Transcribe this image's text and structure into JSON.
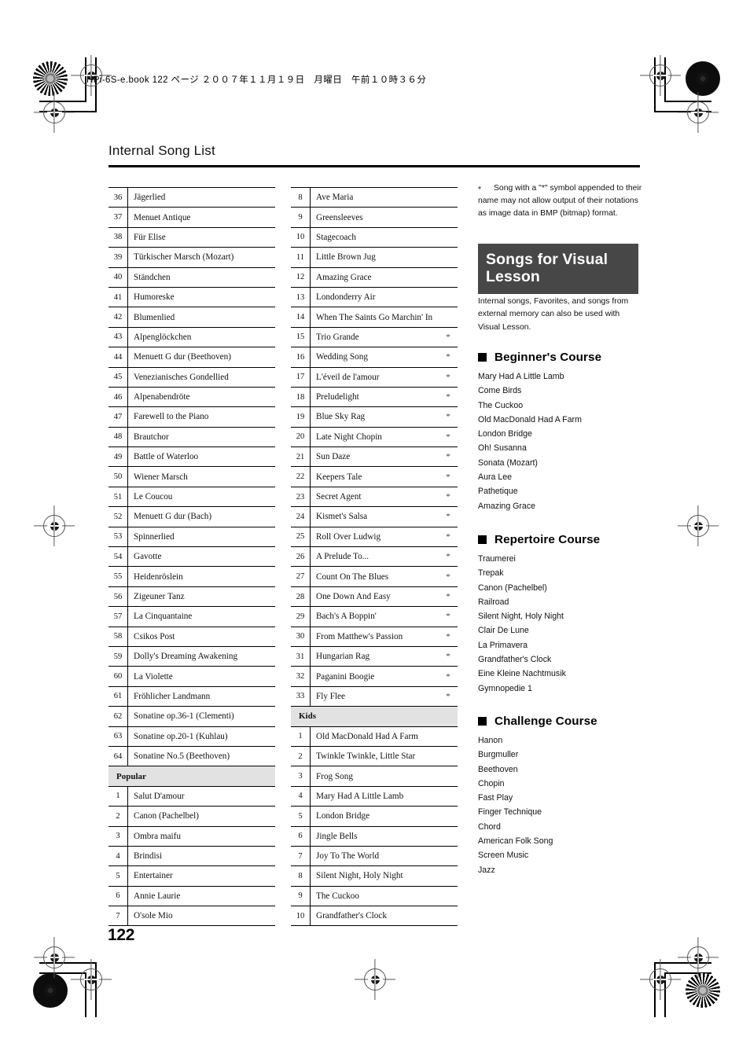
{
  "document": {
    "meta_line": "HPi-6S-e.book  122 ページ  ２００７年１１月１９日　月曜日　午前１０時３６分",
    "header_title": "Internal Song List",
    "page_number": "122"
  },
  "footnote": {
    "marker": "*",
    "text": "Song with a \"*\" symbol appended to their name may not allow output of their notations as image data in BMP (bitmap) format."
  },
  "banner": {
    "title": "Songs for Visual Lesson"
  },
  "intro": {
    "text": "Internal songs, Favorites, and songs from external memory can also be used with Visual Lesson."
  },
  "tables": {
    "column1": [
      {
        "type": "row",
        "num": "36",
        "name": "Jägerlied",
        "mark": ""
      },
      {
        "type": "row",
        "num": "37",
        "name": "Menuet Antique",
        "mark": ""
      },
      {
        "type": "row",
        "num": "38",
        "name": "Für Elise",
        "mark": ""
      },
      {
        "type": "row",
        "num": "39",
        "name": "Türkischer Marsch (Mozart)",
        "mark": ""
      },
      {
        "type": "row",
        "num": "40",
        "name": "Ständchen",
        "mark": ""
      },
      {
        "type": "row",
        "num": "41",
        "name": "Humoreske",
        "mark": ""
      },
      {
        "type": "row",
        "num": "42",
        "name": "Blumenlied",
        "mark": ""
      },
      {
        "type": "row",
        "num": "43",
        "name": "Alpenglöckchen",
        "mark": ""
      },
      {
        "type": "row",
        "num": "44",
        "name": "Menuett G dur (Beethoven)",
        "mark": ""
      },
      {
        "type": "row",
        "num": "45",
        "name": "Venezianisches Gondellied",
        "mark": ""
      },
      {
        "type": "row",
        "num": "46",
        "name": "Alpenabendröte",
        "mark": ""
      },
      {
        "type": "row",
        "num": "47",
        "name": "Farewell to the Piano",
        "mark": ""
      },
      {
        "type": "row",
        "num": "48",
        "name": "Brautchor",
        "mark": ""
      },
      {
        "type": "row",
        "num": "49",
        "name": "Battle of Waterloo",
        "mark": ""
      },
      {
        "type": "row",
        "num": "50",
        "name": "Wiener Marsch",
        "mark": ""
      },
      {
        "type": "row",
        "num": "51",
        "name": "Le Coucou",
        "mark": ""
      },
      {
        "type": "row",
        "num": "52",
        "name": "Menuett G dur (Bach)",
        "mark": ""
      },
      {
        "type": "row",
        "num": "53",
        "name": "Spinnerlied",
        "mark": ""
      },
      {
        "type": "row",
        "num": "54",
        "name": "Gavotte",
        "mark": ""
      },
      {
        "type": "row",
        "num": "55",
        "name": "Heidenröslein",
        "mark": ""
      },
      {
        "type": "row",
        "num": "56",
        "name": "Zigeuner Tanz",
        "mark": ""
      },
      {
        "type": "row",
        "num": "57",
        "name": "La Cinquantaine",
        "mark": ""
      },
      {
        "type": "row",
        "num": "58",
        "name": "Csikos Post",
        "mark": ""
      },
      {
        "type": "row",
        "num": "59",
        "name": "Dolly's Dreaming Awakening",
        "mark": ""
      },
      {
        "type": "row",
        "num": "60",
        "name": "La Violette",
        "mark": ""
      },
      {
        "type": "row",
        "num": "61",
        "name": "Fröhlicher Landmann",
        "mark": ""
      },
      {
        "type": "row",
        "num": "62",
        "name": "Sonatine op.36-1 (Clementi)",
        "mark": ""
      },
      {
        "type": "row",
        "num": "63",
        "name": "Sonatine op.20-1 (Kuhlau)",
        "mark": ""
      },
      {
        "type": "row",
        "num": "64",
        "name": "Sonatine No.5 (Beethoven)",
        "mark": ""
      },
      {
        "type": "section",
        "label": "Popular"
      },
      {
        "type": "row",
        "num": "1",
        "name": "Salut D'amour",
        "mark": ""
      },
      {
        "type": "row",
        "num": "2",
        "name": "Canon (Pachelbel)",
        "mark": ""
      },
      {
        "type": "row",
        "num": "3",
        "name": "Ombra maifu",
        "mark": ""
      },
      {
        "type": "row",
        "num": "4",
        "name": "Brindisi",
        "mark": ""
      },
      {
        "type": "row",
        "num": "5",
        "name": "Entertainer",
        "mark": ""
      },
      {
        "type": "row",
        "num": "6",
        "name": "Annie Laurie",
        "mark": ""
      },
      {
        "type": "row",
        "num": "7",
        "name": "O'sole Mio",
        "mark": ""
      }
    ],
    "column2": [
      {
        "type": "row",
        "num": "8",
        "name": "Ave Maria",
        "mark": ""
      },
      {
        "type": "row",
        "num": "9",
        "name": "Greensleeves",
        "mark": ""
      },
      {
        "type": "row",
        "num": "10",
        "name": "Stagecoach",
        "mark": ""
      },
      {
        "type": "row",
        "num": "11",
        "name": "Little Brown Jug",
        "mark": ""
      },
      {
        "type": "row",
        "num": "12",
        "name": "Amazing Grace",
        "mark": ""
      },
      {
        "type": "row",
        "num": "13",
        "name": "Londonderry Air",
        "mark": ""
      },
      {
        "type": "row",
        "num": "14",
        "name": "When The Saints Go Marchin' In",
        "mark": ""
      },
      {
        "type": "row",
        "num": "15",
        "name": "Trio Grande",
        "mark": "*"
      },
      {
        "type": "row",
        "num": "16",
        "name": "Wedding Song",
        "mark": "*"
      },
      {
        "type": "row",
        "num": "17",
        "name": "L'éveil de l'amour",
        "mark": "*"
      },
      {
        "type": "row",
        "num": "18",
        "name": "Preludelight",
        "mark": "*"
      },
      {
        "type": "row",
        "num": "19",
        "name": "Blue Sky Rag",
        "mark": "*"
      },
      {
        "type": "row",
        "num": "20",
        "name": "Late Night Chopin",
        "mark": "*"
      },
      {
        "type": "row",
        "num": "21",
        "name": "Sun Daze",
        "mark": "*"
      },
      {
        "type": "row",
        "num": "22",
        "name": "Keepers Tale",
        "mark": "*"
      },
      {
        "type": "row",
        "num": "23",
        "name": "Secret Agent",
        "mark": "*"
      },
      {
        "type": "row",
        "num": "24",
        "name": "Kismet's Salsa",
        "mark": "*"
      },
      {
        "type": "row",
        "num": "25",
        "name": "Roll Over Ludwig",
        "mark": "*"
      },
      {
        "type": "row",
        "num": "26",
        "name": "A Prelude To...",
        "mark": "*"
      },
      {
        "type": "row",
        "num": "27",
        "name": "Count On The Blues",
        "mark": "*"
      },
      {
        "type": "row",
        "num": "28",
        "name": "One Down And Easy",
        "mark": "*"
      },
      {
        "type": "row",
        "num": "29",
        "name": "Bach's A Boppin'",
        "mark": "*"
      },
      {
        "type": "row",
        "num": "30",
        "name": "From Matthew's Passion",
        "mark": "*"
      },
      {
        "type": "row",
        "num": "31",
        "name": "Hungarian Rag",
        "mark": "*"
      },
      {
        "type": "row",
        "num": "32",
        "name": "Paganini Boogie",
        "mark": "*"
      },
      {
        "type": "row",
        "num": "33",
        "name": "Fly Flee",
        "mark": "*"
      },
      {
        "type": "section",
        "label": "Kids"
      },
      {
        "type": "row",
        "num": "1",
        "name": "Old MacDonald Had A Farm",
        "mark": ""
      },
      {
        "type": "row",
        "num": "2",
        "name": "Twinkle Twinkle, Little Star",
        "mark": ""
      },
      {
        "type": "row",
        "num": "3",
        "name": "Frog Song",
        "mark": ""
      },
      {
        "type": "row",
        "num": "4",
        "name": "Mary Had A Little Lamb",
        "mark": ""
      },
      {
        "type": "row",
        "num": "5",
        "name": "London Bridge",
        "mark": ""
      },
      {
        "type": "row",
        "num": "6",
        "name": "Jingle Bells",
        "mark": ""
      },
      {
        "type": "row",
        "num": "7",
        "name": "Joy To The World",
        "mark": ""
      },
      {
        "type": "row",
        "num": "8",
        "name": "Silent Night, Holy Night",
        "mark": ""
      },
      {
        "type": "row",
        "num": "9",
        "name": "The Cuckoo",
        "mark": ""
      },
      {
        "type": "row",
        "num": "10",
        "name": "Grandfather's Clock",
        "mark": ""
      }
    ]
  },
  "courses": [
    {
      "id": "beginner",
      "title": "Beginner's Course",
      "songs": [
        "Mary Had A Little Lamb",
        "Come Birds",
        "The Cuckoo",
        "Old MacDonald Had A Farm",
        "London Bridge",
        "Oh! Susanna",
        "Sonata (Mozart)",
        "Aura Lee",
        "Pathetique",
        "Amazing Grace"
      ]
    },
    {
      "id": "repertoire",
      "title": "Repertoire Course",
      "songs": [
        "Traumerei",
        "Trepak",
        "Canon (Pachelbel)",
        "Railroad",
        "Silent Night, Holy Night",
        "Clair De Lune",
        "La Primavera",
        "Grandfather's Clock",
        "Eine Kleine Nachtmusik",
        "Gymnopedie 1"
      ]
    },
    {
      "id": "challenge",
      "title": "Challenge Course",
      "songs": [
        "Hanon",
        "Burgmuller",
        "Beethoven",
        "Chopin",
        "Fast Play",
        "Finger Technique",
        "Chord",
        "American Folk Song",
        "Screen Music",
        "Jazz"
      ]
    }
  ],
  "colors": {
    "banner_bg": "#474747",
    "section_row_bg": "#e2e2e2",
    "rule": "#000000"
  }
}
